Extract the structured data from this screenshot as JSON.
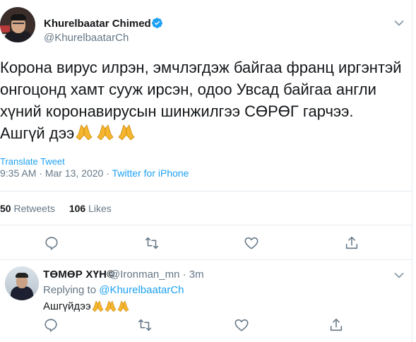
{
  "tweet": {
    "author_name": "Khurelbaatar Chimed",
    "author_handle": "@KhurelbaatarCh",
    "text": "Корона вирус илрэн, эмчлэгдэж байгаа франц иргэнтэй онгоцонд хамт сууж ирсэн, одоо Увсад байгаа англи хүний коронавирусын шинжилгээ СӨРӨГ гарчээ. Ашгүй дээ",
    "emoji": "folded-hands x3",
    "translate_label": "Translate Tweet",
    "time": "9:35 AM",
    "date": "Mar 13, 2020",
    "source": "Twitter for iPhone",
    "retweets_count": "50",
    "retweets_label": "Retweets",
    "likes_count": "106",
    "likes_label": "Likes"
  },
  "reply": {
    "author_name": "ТӨМӨР ХҮН©",
    "author_handle": "@Ironman_mn",
    "time": "3m",
    "replying_prefix": "Replying to",
    "replying_to": "@KhurelbaatarCh",
    "text": "Ашгүйдээ",
    "emoji": "folded-hands x3"
  },
  "icons": {
    "verified": "verified-badge-icon",
    "reply": "reply-icon",
    "retweet": "retweet-icon",
    "like": "like-icon",
    "share": "share-icon",
    "more": "chevron-down-icon"
  },
  "colors": {
    "link": "#1da1f2",
    "secondary_text": "#657786",
    "primary_text": "#14171a",
    "border": "#e6ecf0"
  }
}
